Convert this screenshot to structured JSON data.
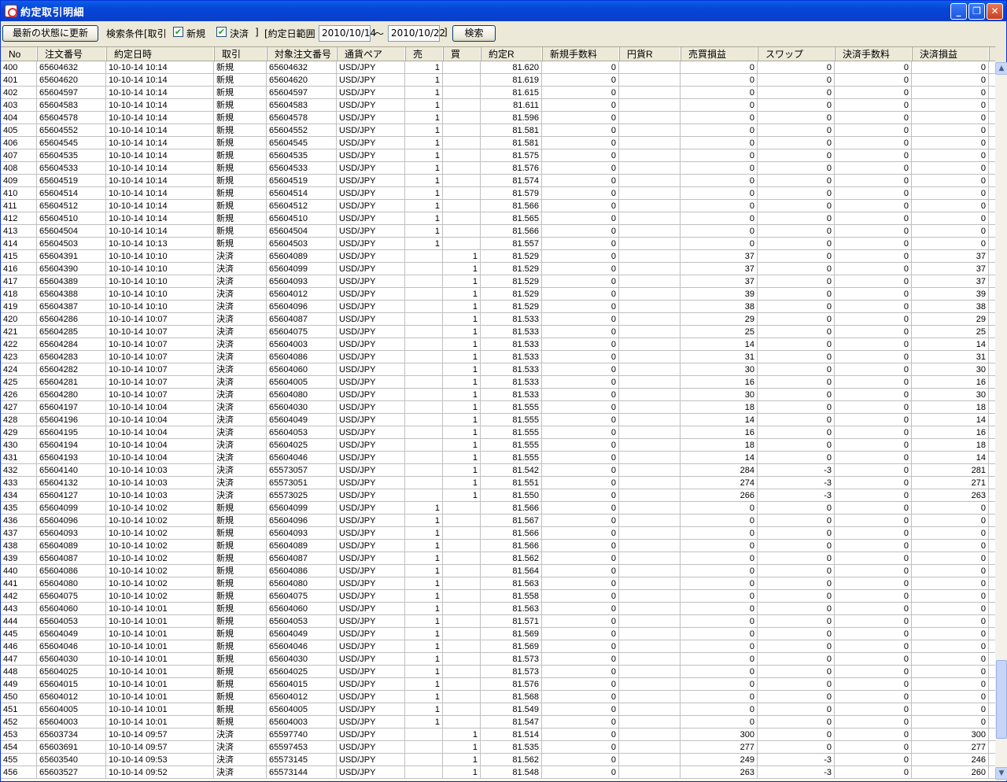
{
  "window": {
    "title": "約定取引明細"
  },
  "toolbar": {
    "refresh_label": "最新の状態に更新",
    "search_condition_label": "検索条件[取引",
    "new_label": "新規",
    "settle_label": "決済",
    "bracket_close": "]",
    "date_range_label": "[約定日範囲",
    "date_from": "2010/10/14",
    "tilde": "～",
    "date_to": "2010/10/22",
    "bracket_close2": "]",
    "search_label": "検索",
    "new_checked": true,
    "settle_checked": true
  },
  "columns": [
    "No",
    "注文番号",
    "約定日時",
    "取引",
    "対象注文番号",
    "通貨ペア",
    "売",
    "買",
    "約定R",
    "新規手数料",
    "円貨R",
    "売買損益",
    "スワップ",
    "決済手数料",
    "決済損益"
  ],
  "rows": [
    [
      "400",
      "65604632",
      "10-10-14 10:14",
      "新規",
      "65604632",
      "USD/JPY",
      "1",
      "",
      "81.620",
      "0",
      "",
      "0",
      "0",
      "0",
      "0"
    ],
    [
      "401",
      "65604620",
      "10-10-14 10:14",
      "新規",
      "65604620",
      "USD/JPY",
      "1",
      "",
      "81.619",
      "0",
      "",
      "0",
      "0",
      "0",
      "0"
    ],
    [
      "402",
      "65604597",
      "10-10-14 10:14",
      "新規",
      "65604597",
      "USD/JPY",
      "1",
      "",
      "81.615",
      "0",
      "",
      "0",
      "0",
      "0",
      "0"
    ],
    [
      "403",
      "65604583",
      "10-10-14 10:14",
      "新規",
      "65604583",
      "USD/JPY",
      "1",
      "",
      "81.611",
      "0",
      "",
      "0",
      "0",
      "0",
      "0"
    ],
    [
      "404",
      "65604578",
      "10-10-14 10:14",
      "新規",
      "65604578",
      "USD/JPY",
      "1",
      "",
      "81.596",
      "0",
      "",
      "0",
      "0",
      "0",
      "0"
    ],
    [
      "405",
      "65604552",
      "10-10-14 10:14",
      "新規",
      "65604552",
      "USD/JPY",
      "1",
      "",
      "81.581",
      "0",
      "",
      "0",
      "0",
      "0",
      "0"
    ],
    [
      "406",
      "65604545",
      "10-10-14 10:14",
      "新規",
      "65604545",
      "USD/JPY",
      "1",
      "",
      "81.581",
      "0",
      "",
      "0",
      "0",
      "0",
      "0"
    ],
    [
      "407",
      "65604535",
      "10-10-14 10:14",
      "新規",
      "65604535",
      "USD/JPY",
      "1",
      "",
      "81.575",
      "0",
      "",
      "0",
      "0",
      "0",
      "0"
    ],
    [
      "408",
      "65604533",
      "10-10-14 10:14",
      "新規",
      "65604533",
      "USD/JPY",
      "1",
      "",
      "81.576",
      "0",
      "",
      "0",
      "0",
      "0",
      "0"
    ],
    [
      "409",
      "65604519",
      "10-10-14 10:14",
      "新規",
      "65604519",
      "USD/JPY",
      "1",
      "",
      "81.574",
      "0",
      "",
      "0",
      "0",
      "0",
      "0"
    ],
    [
      "410",
      "65604514",
      "10-10-14 10:14",
      "新規",
      "65604514",
      "USD/JPY",
      "1",
      "",
      "81.579",
      "0",
      "",
      "0",
      "0",
      "0",
      "0"
    ],
    [
      "411",
      "65604512",
      "10-10-14 10:14",
      "新規",
      "65604512",
      "USD/JPY",
      "1",
      "",
      "81.566",
      "0",
      "",
      "0",
      "0",
      "0",
      "0"
    ],
    [
      "412",
      "65604510",
      "10-10-14 10:14",
      "新規",
      "65604510",
      "USD/JPY",
      "1",
      "",
      "81.565",
      "0",
      "",
      "0",
      "0",
      "0",
      "0"
    ],
    [
      "413",
      "65604504",
      "10-10-14 10:14",
      "新規",
      "65604504",
      "USD/JPY",
      "1",
      "",
      "81.566",
      "0",
      "",
      "0",
      "0",
      "0",
      "0"
    ],
    [
      "414",
      "65604503",
      "10-10-14 10:13",
      "新規",
      "65604503",
      "USD/JPY",
      "1",
      "",
      "81.557",
      "0",
      "",
      "0",
      "0",
      "0",
      "0"
    ],
    [
      "415",
      "65604391",
      "10-10-14 10:10",
      "決済",
      "65604089",
      "USD/JPY",
      "",
      "1",
      "81.529",
      "0",
      "",
      "37",
      "0",
      "0",
      "37"
    ],
    [
      "416",
      "65604390",
      "10-10-14 10:10",
      "決済",
      "65604099",
      "USD/JPY",
      "",
      "1",
      "81.529",
      "0",
      "",
      "37",
      "0",
      "0",
      "37"
    ],
    [
      "417",
      "65604389",
      "10-10-14 10:10",
      "決済",
      "65604093",
      "USD/JPY",
      "",
      "1",
      "81.529",
      "0",
      "",
      "37",
      "0",
      "0",
      "37"
    ],
    [
      "418",
      "65604388",
      "10-10-14 10:10",
      "決済",
      "65604012",
      "USD/JPY",
      "",
      "1",
      "81.529",
      "0",
      "",
      "39",
      "0",
      "0",
      "39"
    ],
    [
      "419",
      "65604387",
      "10-10-14 10:10",
      "決済",
      "65604096",
      "USD/JPY",
      "",
      "1",
      "81.529",
      "0",
      "",
      "38",
      "0",
      "0",
      "38"
    ],
    [
      "420",
      "65604286",
      "10-10-14 10:07",
      "決済",
      "65604087",
      "USD/JPY",
      "",
      "1",
      "81.533",
      "0",
      "",
      "29",
      "0",
      "0",
      "29"
    ],
    [
      "421",
      "65604285",
      "10-10-14 10:07",
      "決済",
      "65604075",
      "USD/JPY",
      "",
      "1",
      "81.533",
      "0",
      "",
      "25",
      "0",
      "0",
      "25"
    ],
    [
      "422",
      "65604284",
      "10-10-14 10:07",
      "決済",
      "65604003",
      "USD/JPY",
      "",
      "1",
      "81.533",
      "0",
      "",
      "14",
      "0",
      "0",
      "14"
    ],
    [
      "423",
      "65604283",
      "10-10-14 10:07",
      "決済",
      "65604086",
      "USD/JPY",
      "",
      "1",
      "81.533",
      "0",
      "",
      "31",
      "0",
      "0",
      "31"
    ],
    [
      "424",
      "65604282",
      "10-10-14 10:07",
      "決済",
      "65604060",
      "USD/JPY",
      "",
      "1",
      "81.533",
      "0",
      "",
      "30",
      "0",
      "0",
      "30"
    ],
    [
      "425",
      "65604281",
      "10-10-14 10:07",
      "決済",
      "65604005",
      "USD/JPY",
      "",
      "1",
      "81.533",
      "0",
      "",
      "16",
      "0",
      "0",
      "16"
    ],
    [
      "426",
      "65604280",
      "10-10-14 10:07",
      "決済",
      "65604080",
      "USD/JPY",
      "",
      "1",
      "81.533",
      "0",
      "",
      "30",
      "0",
      "0",
      "30"
    ],
    [
      "427",
      "65604197",
      "10-10-14 10:04",
      "決済",
      "65604030",
      "USD/JPY",
      "",
      "1",
      "81.555",
      "0",
      "",
      "18",
      "0",
      "0",
      "18"
    ],
    [
      "428",
      "65604196",
      "10-10-14 10:04",
      "決済",
      "65604049",
      "USD/JPY",
      "",
      "1",
      "81.555",
      "0",
      "",
      "14",
      "0",
      "0",
      "14"
    ],
    [
      "429",
      "65604195",
      "10-10-14 10:04",
      "決済",
      "65604053",
      "USD/JPY",
      "",
      "1",
      "81.555",
      "0",
      "",
      "16",
      "0",
      "0",
      "16"
    ],
    [
      "430",
      "65604194",
      "10-10-14 10:04",
      "決済",
      "65604025",
      "USD/JPY",
      "",
      "1",
      "81.555",
      "0",
      "",
      "18",
      "0",
      "0",
      "18"
    ],
    [
      "431",
      "65604193",
      "10-10-14 10:04",
      "決済",
      "65604046",
      "USD/JPY",
      "",
      "1",
      "81.555",
      "0",
      "",
      "14",
      "0",
      "0",
      "14"
    ],
    [
      "432",
      "65604140",
      "10-10-14 10:03",
      "決済",
      "65573057",
      "USD/JPY",
      "",
      "1",
      "81.542",
      "0",
      "",
      "284",
      "-3",
      "0",
      "281"
    ],
    [
      "433",
      "65604132",
      "10-10-14 10:03",
      "決済",
      "65573051",
      "USD/JPY",
      "",
      "1",
      "81.551",
      "0",
      "",
      "274",
      "-3",
      "0",
      "271"
    ],
    [
      "434",
      "65604127",
      "10-10-14 10:03",
      "決済",
      "65573025",
      "USD/JPY",
      "",
      "1",
      "81.550",
      "0",
      "",
      "266",
      "-3",
      "0",
      "263"
    ],
    [
      "435",
      "65604099",
      "10-10-14 10:02",
      "新規",
      "65604099",
      "USD/JPY",
      "1",
      "",
      "81.566",
      "0",
      "",
      "0",
      "0",
      "0",
      "0"
    ],
    [
      "436",
      "65604096",
      "10-10-14 10:02",
      "新規",
      "65604096",
      "USD/JPY",
      "1",
      "",
      "81.567",
      "0",
      "",
      "0",
      "0",
      "0",
      "0"
    ],
    [
      "437",
      "65604093",
      "10-10-14 10:02",
      "新規",
      "65604093",
      "USD/JPY",
      "1",
      "",
      "81.566",
      "0",
      "",
      "0",
      "0",
      "0",
      "0"
    ],
    [
      "438",
      "65604089",
      "10-10-14 10:02",
      "新規",
      "65604089",
      "USD/JPY",
      "1",
      "",
      "81.566",
      "0",
      "",
      "0",
      "0",
      "0",
      "0"
    ],
    [
      "439",
      "65604087",
      "10-10-14 10:02",
      "新規",
      "65604087",
      "USD/JPY",
      "1",
      "",
      "81.562",
      "0",
      "",
      "0",
      "0",
      "0",
      "0"
    ],
    [
      "440",
      "65604086",
      "10-10-14 10:02",
      "新規",
      "65604086",
      "USD/JPY",
      "1",
      "",
      "81.564",
      "0",
      "",
      "0",
      "0",
      "0",
      "0"
    ],
    [
      "441",
      "65604080",
      "10-10-14 10:02",
      "新規",
      "65604080",
      "USD/JPY",
      "1",
      "",
      "81.563",
      "0",
      "",
      "0",
      "0",
      "0",
      "0"
    ],
    [
      "442",
      "65604075",
      "10-10-14 10:02",
      "新規",
      "65604075",
      "USD/JPY",
      "1",
      "",
      "81.558",
      "0",
      "",
      "0",
      "0",
      "0",
      "0"
    ],
    [
      "443",
      "65604060",
      "10-10-14 10:01",
      "新規",
      "65604060",
      "USD/JPY",
      "1",
      "",
      "81.563",
      "0",
      "",
      "0",
      "0",
      "0",
      "0"
    ],
    [
      "444",
      "65604053",
      "10-10-14 10:01",
      "新規",
      "65604053",
      "USD/JPY",
      "1",
      "",
      "81.571",
      "0",
      "",
      "0",
      "0",
      "0",
      "0"
    ],
    [
      "445",
      "65604049",
      "10-10-14 10:01",
      "新規",
      "65604049",
      "USD/JPY",
      "1",
      "",
      "81.569",
      "0",
      "",
      "0",
      "0",
      "0",
      "0"
    ],
    [
      "446",
      "65604046",
      "10-10-14 10:01",
      "新規",
      "65604046",
      "USD/JPY",
      "1",
      "",
      "81.569",
      "0",
      "",
      "0",
      "0",
      "0",
      "0"
    ],
    [
      "447",
      "65604030",
      "10-10-14 10:01",
      "新規",
      "65604030",
      "USD/JPY",
      "1",
      "",
      "81.573",
      "0",
      "",
      "0",
      "0",
      "0",
      "0"
    ],
    [
      "448",
      "65604025",
      "10-10-14 10:01",
      "新規",
      "65604025",
      "USD/JPY",
      "1",
      "",
      "81.573",
      "0",
      "",
      "0",
      "0",
      "0",
      "0"
    ],
    [
      "449",
      "65604015",
      "10-10-14 10:01",
      "新規",
      "65604015",
      "USD/JPY",
      "1",
      "",
      "81.576",
      "0",
      "",
      "0",
      "0",
      "0",
      "0"
    ],
    [
      "450",
      "65604012",
      "10-10-14 10:01",
      "新規",
      "65604012",
      "USD/JPY",
      "1",
      "",
      "81.568",
      "0",
      "",
      "0",
      "0",
      "0",
      "0"
    ],
    [
      "451",
      "65604005",
      "10-10-14 10:01",
      "新規",
      "65604005",
      "USD/JPY",
      "1",
      "",
      "81.549",
      "0",
      "",
      "0",
      "0",
      "0",
      "0"
    ],
    [
      "452",
      "65604003",
      "10-10-14 10:01",
      "新規",
      "65604003",
      "USD/JPY",
      "1",
      "",
      "81.547",
      "0",
      "",
      "0",
      "0",
      "0",
      "0"
    ],
    [
      "453",
      "65603734",
      "10-10-14 09:57",
      "決済",
      "65597740",
      "USD/JPY",
      "",
      "1",
      "81.514",
      "0",
      "",
      "300",
      "0",
      "0",
      "300"
    ],
    [
      "454",
      "65603691",
      "10-10-14 09:57",
      "決済",
      "65597453",
      "USD/JPY",
      "",
      "1",
      "81.535",
      "0",
      "",
      "277",
      "0",
      "0",
      "277"
    ],
    [
      "455",
      "65603540",
      "10-10-14 09:53",
      "決済",
      "65573145",
      "USD/JPY",
      "",
      "1",
      "81.562",
      "0",
      "",
      "249",
      "-3",
      "0",
      "246"
    ],
    [
      "456",
      "65603527",
      "10-10-14 09:52",
      "決済",
      "65573144",
      "USD/JPY",
      "",
      "1",
      "81.548",
      "0",
      "",
      "263",
      "-3",
      "0",
      "260"
    ]
  ],
  "scrollbar": {
    "up_icon": "scroll-up-icon",
    "down_icon": "scroll-down-icon"
  },
  "titlebar_buttons": {
    "minimize": "_",
    "maximize": "❐",
    "close": "✕"
  }
}
